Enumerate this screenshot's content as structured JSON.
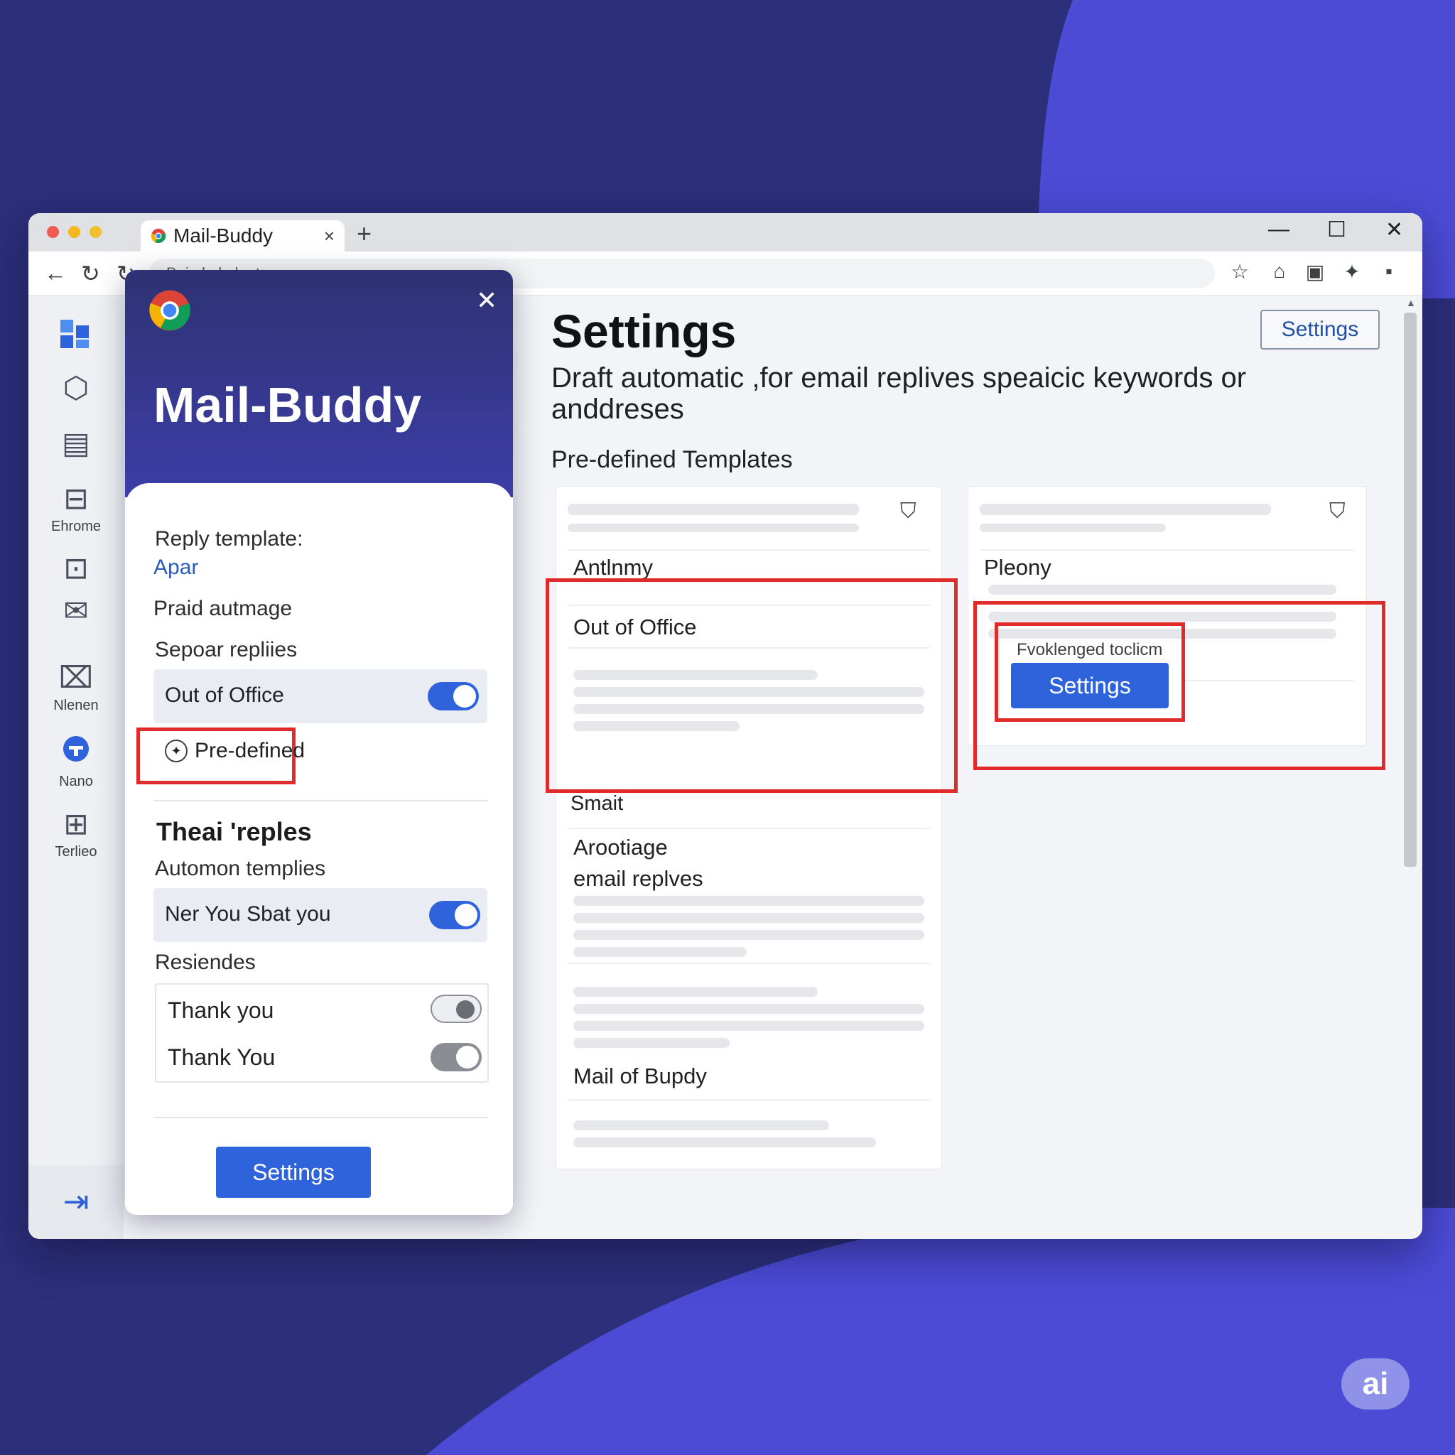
{
  "colors": {
    "background_dark": "#2c2f7a",
    "background_accent": "#4b4bd6",
    "primary": "#2f63db",
    "highlight_red": "#e02b2b"
  },
  "browser": {
    "tab_title": "Mail-Buddy",
    "tab_close": "×",
    "new_tab": "+",
    "window_min": "—",
    "window_max": "☐",
    "window_close": "✕",
    "address_text": "B..i...k..l...k...t",
    "toolbar_icons": [
      "star-icon",
      "home-icon",
      "puzzle-icon",
      "extension-icon",
      "profile-icon",
      "menu-icon"
    ]
  },
  "rail": {
    "items": [
      {
        "icon": "apps-icon",
        "label": ""
      },
      {
        "icon": "settings-icon",
        "label": ""
      },
      {
        "icon": "calendar-icon",
        "label": ""
      },
      {
        "icon": "briefcase-icon",
        "label": "Ehrome"
      },
      {
        "icon": "folder-icon",
        "label": ""
      },
      {
        "icon": "mail-icon",
        "label": ""
      },
      {
        "icon": "message-icon",
        "label": "Nlenen"
      },
      {
        "icon": "chat-icon",
        "label": "Nano"
      },
      {
        "icon": "document-icon",
        "label": "Terlieo"
      }
    ],
    "footer_icon": "sign-out-icon"
  },
  "popup": {
    "title": "Mail-Buddy",
    "close": "✕",
    "reply_template_heading": "Reply template:",
    "link": "Apar",
    "item_2": "Praid autmage",
    "item_3": "Sepoar repliies",
    "out_of_office_label": "Out of Office",
    "out_of_office_on": true,
    "predefined_label": "Pre-defined",
    "section_heading": "Theai 'reples",
    "section_sub": "Automon templies",
    "ner_row_label": "Ner You Sbat you",
    "ner_row_on": true,
    "residence_heading": "Resiendes",
    "thank_you_1": "Thank you",
    "thank_you_2": "Thank You",
    "thank_you_1_on": false,
    "thank_you_2_on": false,
    "settings_button": "Settings"
  },
  "main": {
    "title": "Settings",
    "top_button": "Settings",
    "description": "Draft automatic ,for email replives speaicic keywords or anddreses",
    "sub_heading": "Pre-defined Templates",
    "card_a": {
      "label_1": "Antlnmy",
      "label_2": "Out of Office",
      "label_3": "Smait",
      "label_4_line1": "Arootiage",
      "label_4_line2": "email replves",
      "label_5": "Mail of Bupdy"
    },
    "card_b": {
      "label_1": "Pleony",
      "caption": "Fvoklenged toclicm",
      "button": "Settings"
    }
  },
  "badge": "ai"
}
